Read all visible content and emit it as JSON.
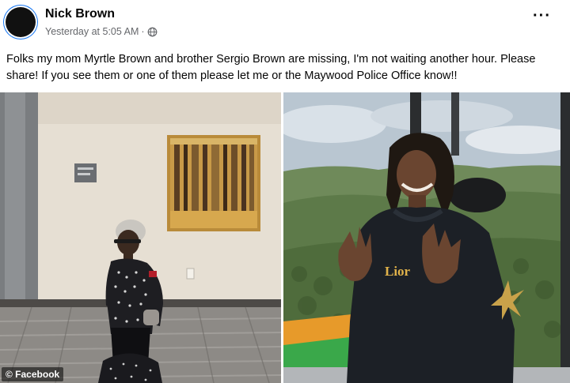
{
  "post": {
    "author": "Nick Brown",
    "timestamp": "Yesterday at 5:05 AM",
    "separator": "·",
    "privacy_icon": "globe-icon",
    "more_options": "···",
    "text": "Folks my mom Myrtle Brown and brother Sergio Brown are missing, I'm not waiting another hour. Please share! If you see them or one of them please let me or the Maywood Police Office know!!"
  },
  "photos": {
    "left_description": "woman-standing-in-hallway",
    "right_description": "man-gesturing-in-gondola",
    "hoodie_text": "Lior"
  },
  "watermark": "© Facebook"
}
